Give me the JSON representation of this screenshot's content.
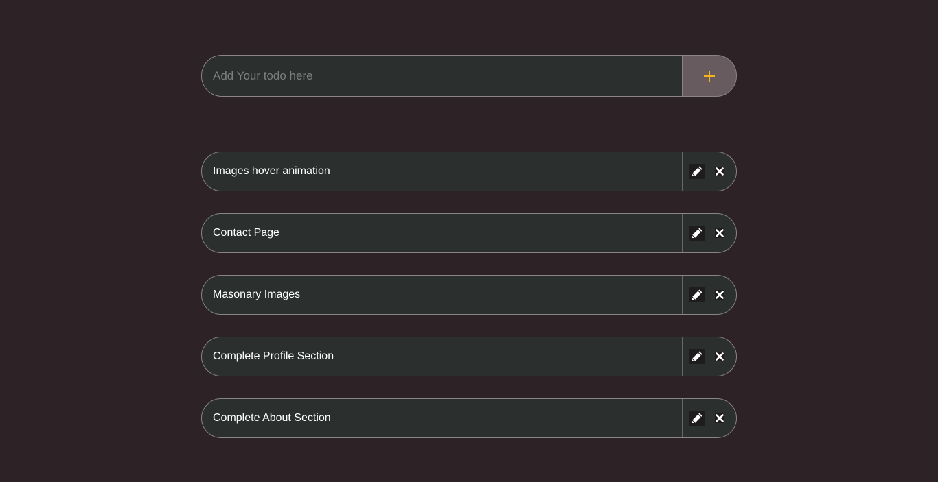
{
  "add_form": {
    "placeholder": "Add Your todo here",
    "value": "",
    "button_icon": "plus-icon",
    "accent_color": "#f4b41a"
  },
  "todos": [
    {
      "text": "Images hover animation",
      "edit_icon": "pencil-icon",
      "delete_icon": "close-icon"
    },
    {
      "text": "Contact Page",
      "edit_icon": "pencil-icon",
      "delete_icon": "close-icon"
    },
    {
      "text": "Masonary Images",
      "edit_icon": "pencil-icon",
      "delete_icon": "close-icon"
    },
    {
      "text": "Complete Profile Section",
      "edit_icon": "pencil-icon",
      "delete_icon": "close-icon"
    },
    {
      "text": "Complete About Section",
      "edit_icon": "pencil-icon",
      "delete_icon": "close-icon"
    }
  ],
  "colors": {
    "background": "#2d2226",
    "field": "#2b2f2e",
    "border": "#8a8486",
    "add_button": "#675b5f",
    "text": "#ffffff"
  }
}
